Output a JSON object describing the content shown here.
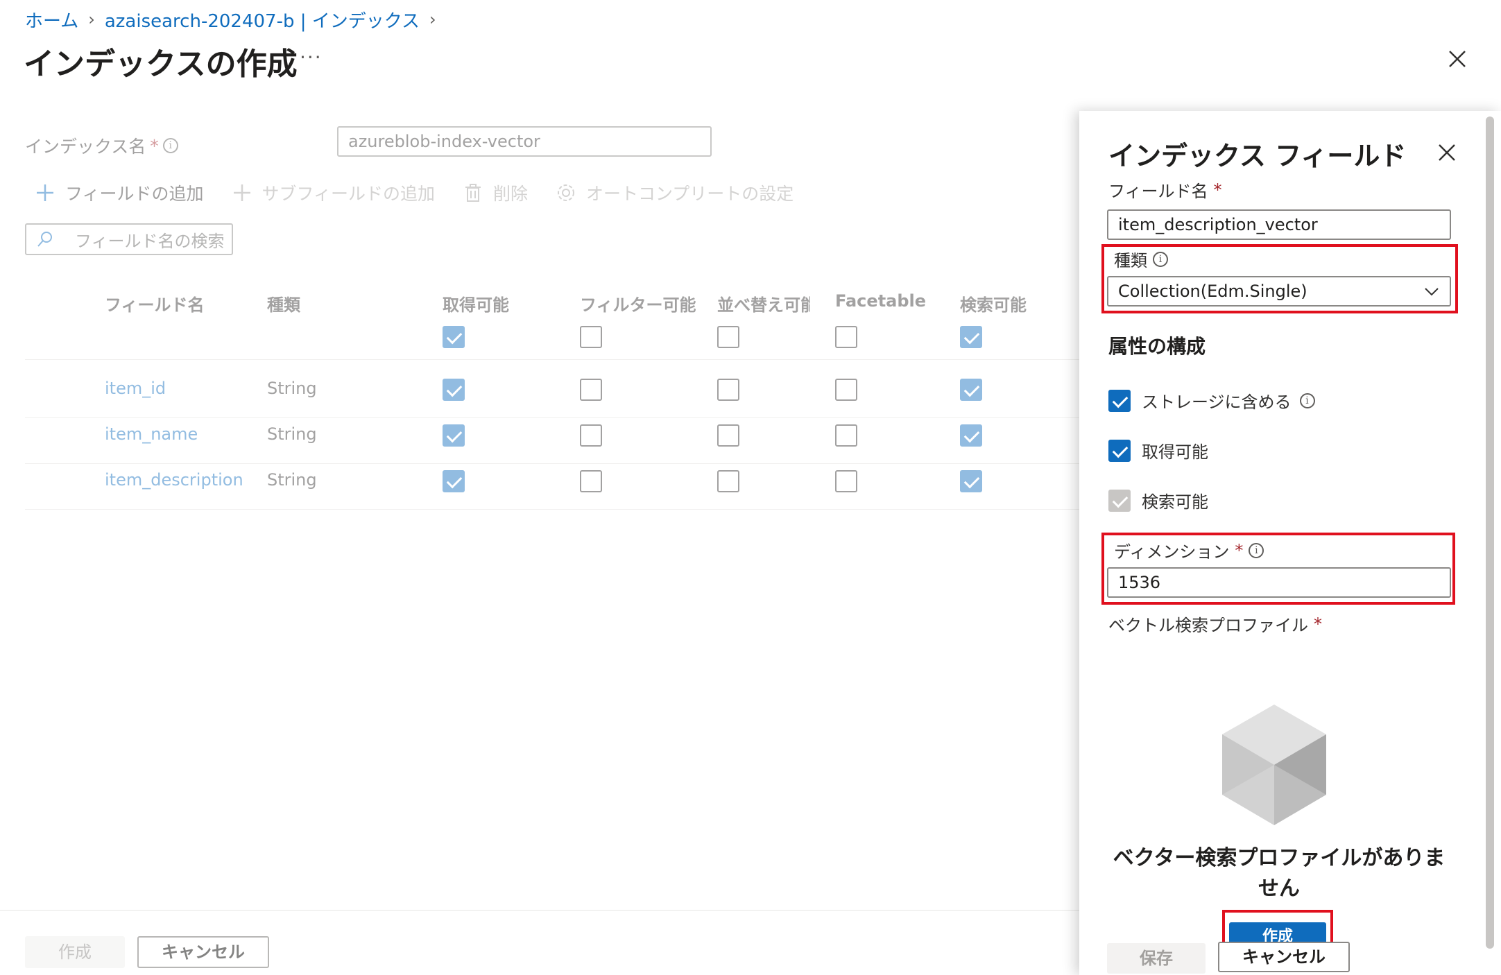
{
  "breadcrumb": {
    "home": "ホーム",
    "service": "azaisearch-202407-b | インデックス"
  },
  "page": {
    "title": "インデックスの作成",
    "more": "···"
  },
  "main": {
    "index_name_label": "インデックス名",
    "required_mark": "*",
    "index_name_value": "azureblob-index-vector",
    "toolbar": {
      "add_field": "フィールドの追加",
      "add_subfield": "サブフィールドの追加",
      "delete": "削除",
      "autocomplete": "オートコンプリートの設定"
    },
    "search_placeholder": "フィールド名の検索",
    "columns": [
      "フィールド名",
      "種類",
      "取得可能",
      "フィルター可能",
      "並べ替え可能",
      "Facetable",
      "検索可能"
    ],
    "rows": [
      {
        "name": "item_id",
        "type": "String"
      },
      {
        "name": "item_name",
        "type": "String"
      },
      {
        "name": "item_description",
        "type": "String"
      }
    ],
    "create_button": "作成",
    "cancel_button": "キャンセル"
  },
  "panel": {
    "title": "インデックス フィールド",
    "field_name_label": "フィールド名",
    "field_name_value": "item_description_vector",
    "type_label": "種類",
    "type_value": "Collection(Edm.Single)",
    "attributes_title": "属性の構成",
    "attr_storage": "ストレージに含める",
    "attr_retrievable": "取得可能",
    "attr_searchable": "検索可能",
    "dimension_label": "ディメンション",
    "dimension_value": "1536",
    "profile_label": "ベクトル検索プロファイル",
    "empty_text": "ベクター検索プロファイルがありません",
    "create_button": "作成",
    "save_button": "保存",
    "cancel_button": "キャンセル"
  },
  "colors": {
    "accent": "#0f6cbd",
    "highlight": "#e0101e"
  }
}
